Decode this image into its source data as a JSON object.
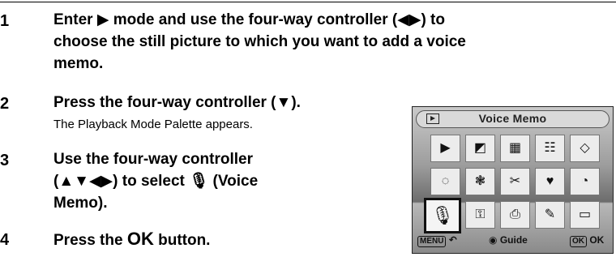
{
  "steps": [
    {
      "number": "1",
      "lines": [
        "Enter ▶ mode and use the four-way controller (◀▶) to",
        "choose the still picture to which you want to add a voice",
        "memo."
      ]
    },
    {
      "number": "2",
      "line": "Press the four-way controller (▼).",
      "sub": "The Playback Mode Palette appears."
    },
    {
      "number": "3",
      "lines": [
        "Use the four-way controller",
        "(▲▼◀▶) to select 🎙 (Voice",
        "Memo)."
      ]
    },
    {
      "number": "4",
      "before": "Press the ",
      "ok": "OK",
      "after": " button."
    }
  ],
  "screen": {
    "title": "Voice Memo",
    "bottom": {
      "menu": "MENU",
      "guide": "Guide",
      "ok_badge": "OK",
      "ok_text": "OK"
    },
    "icons": [
      [
        "▶",
        "◩",
        "▦",
        "☷",
        "◇"
      ],
      [
        "◌",
        "❃",
        "✂",
        "♥",
        "◔"
      ],
      [
        "🎙",
        "⚿",
        "⎙",
        "✎",
        "▭"
      ]
    ],
    "selected_icon": "voice-memo"
  }
}
